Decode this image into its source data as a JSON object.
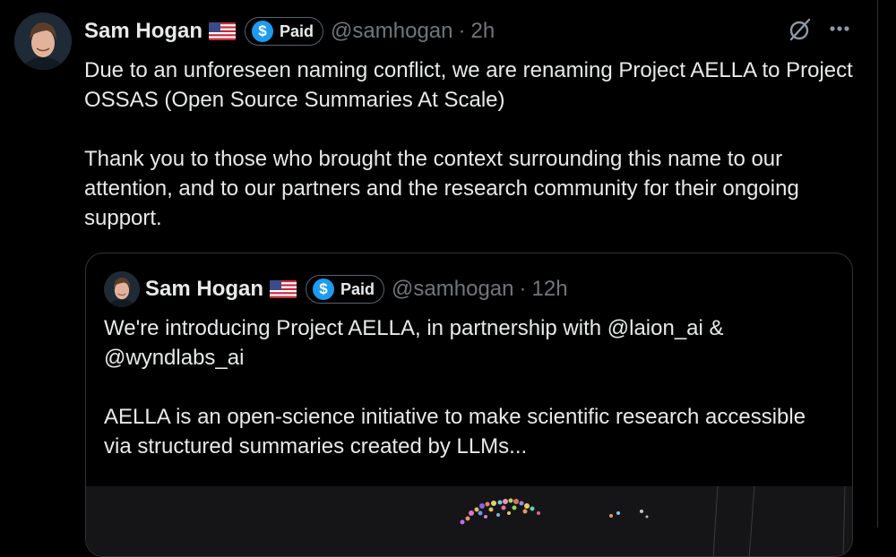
{
  "tweet": {
    "author_name": "Sam Hogan",
    "flag": "us-flag-icon",
    "badge_label": "Paid",
    "badge_icon": "dollar-icon",
    "handle": "@samhogan",
    "separator": "·",
    "time": "2h",
    "paragraphs": [
      "Due to an unforeseen naming conflict, we are renaming Project AELLA to Project OSSAS (Open Source Summaries At Scale)",
      "Thank you to those who brought the context surrounding this name to our attention, and to our partners and the research community for their ongoing support."
    ]
  },
  "quoted_tweet": {
    "author_name": "Sam Hogan",
    "flag": "us-flag-icon",
    "badge_label": "Paid",
    "badge_icon": "dollar-icon",
    "handle": "@samhogan",
    "separator": "·",
    "time": "12h",
    "paragraphs": [
      "We're introducing Project AELLA, in partnership with @laion_ai & @wyndlabs_ai",
      "AELLA is an open-science initiative to make scientific research accessible via structured summaries created by LLMs..."
    ]
  },
  "icons": {
    "grok": "grok-icon",
    "more": "more-icon",
    "dollar_symbol": "$"
  },
  "colors": {
    "background": "#000000",
    "text": "#e7e9ea",
    "secondary_text": "#71767b",
    "border": "#2f3336",
    "badge_blue": "#1d9bf0"
  }
}
